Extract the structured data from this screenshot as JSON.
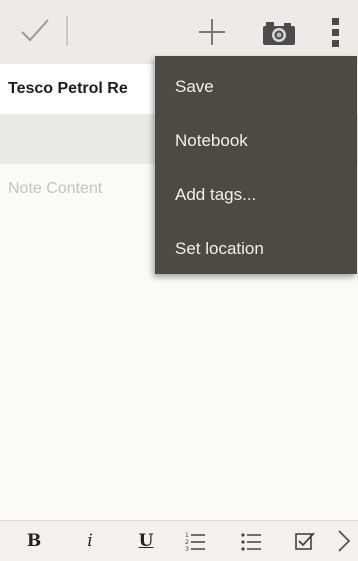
{
  "toolbar": {
    "icons": [
      "checkmark-icon",
      "plus-icon",
      "camera-icon",
      "overflow-menu-icon"
    ]
  },
  "note": {
    "title": "Tesco Petrol Re",
    "content_placeholder": "Note Content"
  },
  "menu": {
    "items": [
      "Save",
      "Notebook",
      "Add tags...",
      "Set location"
    ]
  },
  "format_bar": {
    "bold_label": "B",
    "italic_label": "i",
    "underline_label": "U",
    "icons": [
      "numbered-list-icon",
      "bulleted-list-icon",
      "checkbox-icon",
      "chevron-right-icon"
    ]
  },
  "colors": {
    "menu_bg": "#4d4a45",
    "menu_text": "#f0f0f0",
    "toolbar_bg": "#ecebe7",
    "placeholder": "#c3c3c3"
  }
}
